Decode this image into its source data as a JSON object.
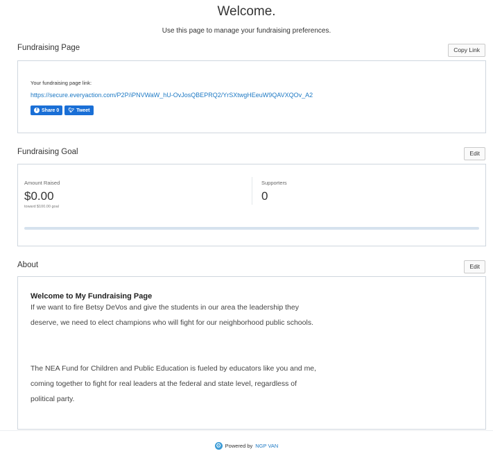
{
  "header": {
    "title": "Welcome.",
    "subtitle": "Use this page to manage your fundraising preferences."
  },
  "fundraising_page": {
    "label": "Fundraising Page",
    "copy_button": "Copy Link",
    "link_label": "Your fundraising page link:",
    "link_url": "https://secure.everyaction.com/P2P/iPNVWaW_hU-OvJosQBEPRQ2/YrSXtwgHEeuW9QAVXQOv_A2",
    "share_label": "Share 0",
    "tweet_label": "Tweet"
  },
  "fundraising_goal": {
    "label": "Fundraising Goal",
    "edit_button": "Edit",
    "amount_label": "Amount Raised",
    "amount_value": "$0.00",
    "goal_text": "toward $100.00 goal",
    "supporters_label": "Supporters",
    "supporters_value": "0",
    "progress_fraction": 0
  },
  "about": {
    "label": "About",
    "edit_button": "Edit",
    "heading": "Welcome to My Fundraising Page",
    "paragraph1": "If we want to fire Betsy DeVos and give the students in our area the leadership they deserve, we need to elect champions who will fight for our neighborhood public schools.",
    "paragraph2": "The NEA Fund for Children and Public Education is fueled by educators like you and me, coming together to fight for real leaders at the federal and state level, regardless of political party."
  },
  "footer": {
    "powered_by": "Powered by",
    "brand": "NGP VAN"
  },
  "icons": {
    "facebook": "facebook-icon",
    "twitter": "twitter-icon",
    "footer": "ngpvan-gear-icon"
  },
  "colors": {
    "link": "#1d79c4",
    "social_button": "#1a6fd6",
    "progress_track": "#d6e2ee",
    "box_border": "#cfd6de"
  }
}
